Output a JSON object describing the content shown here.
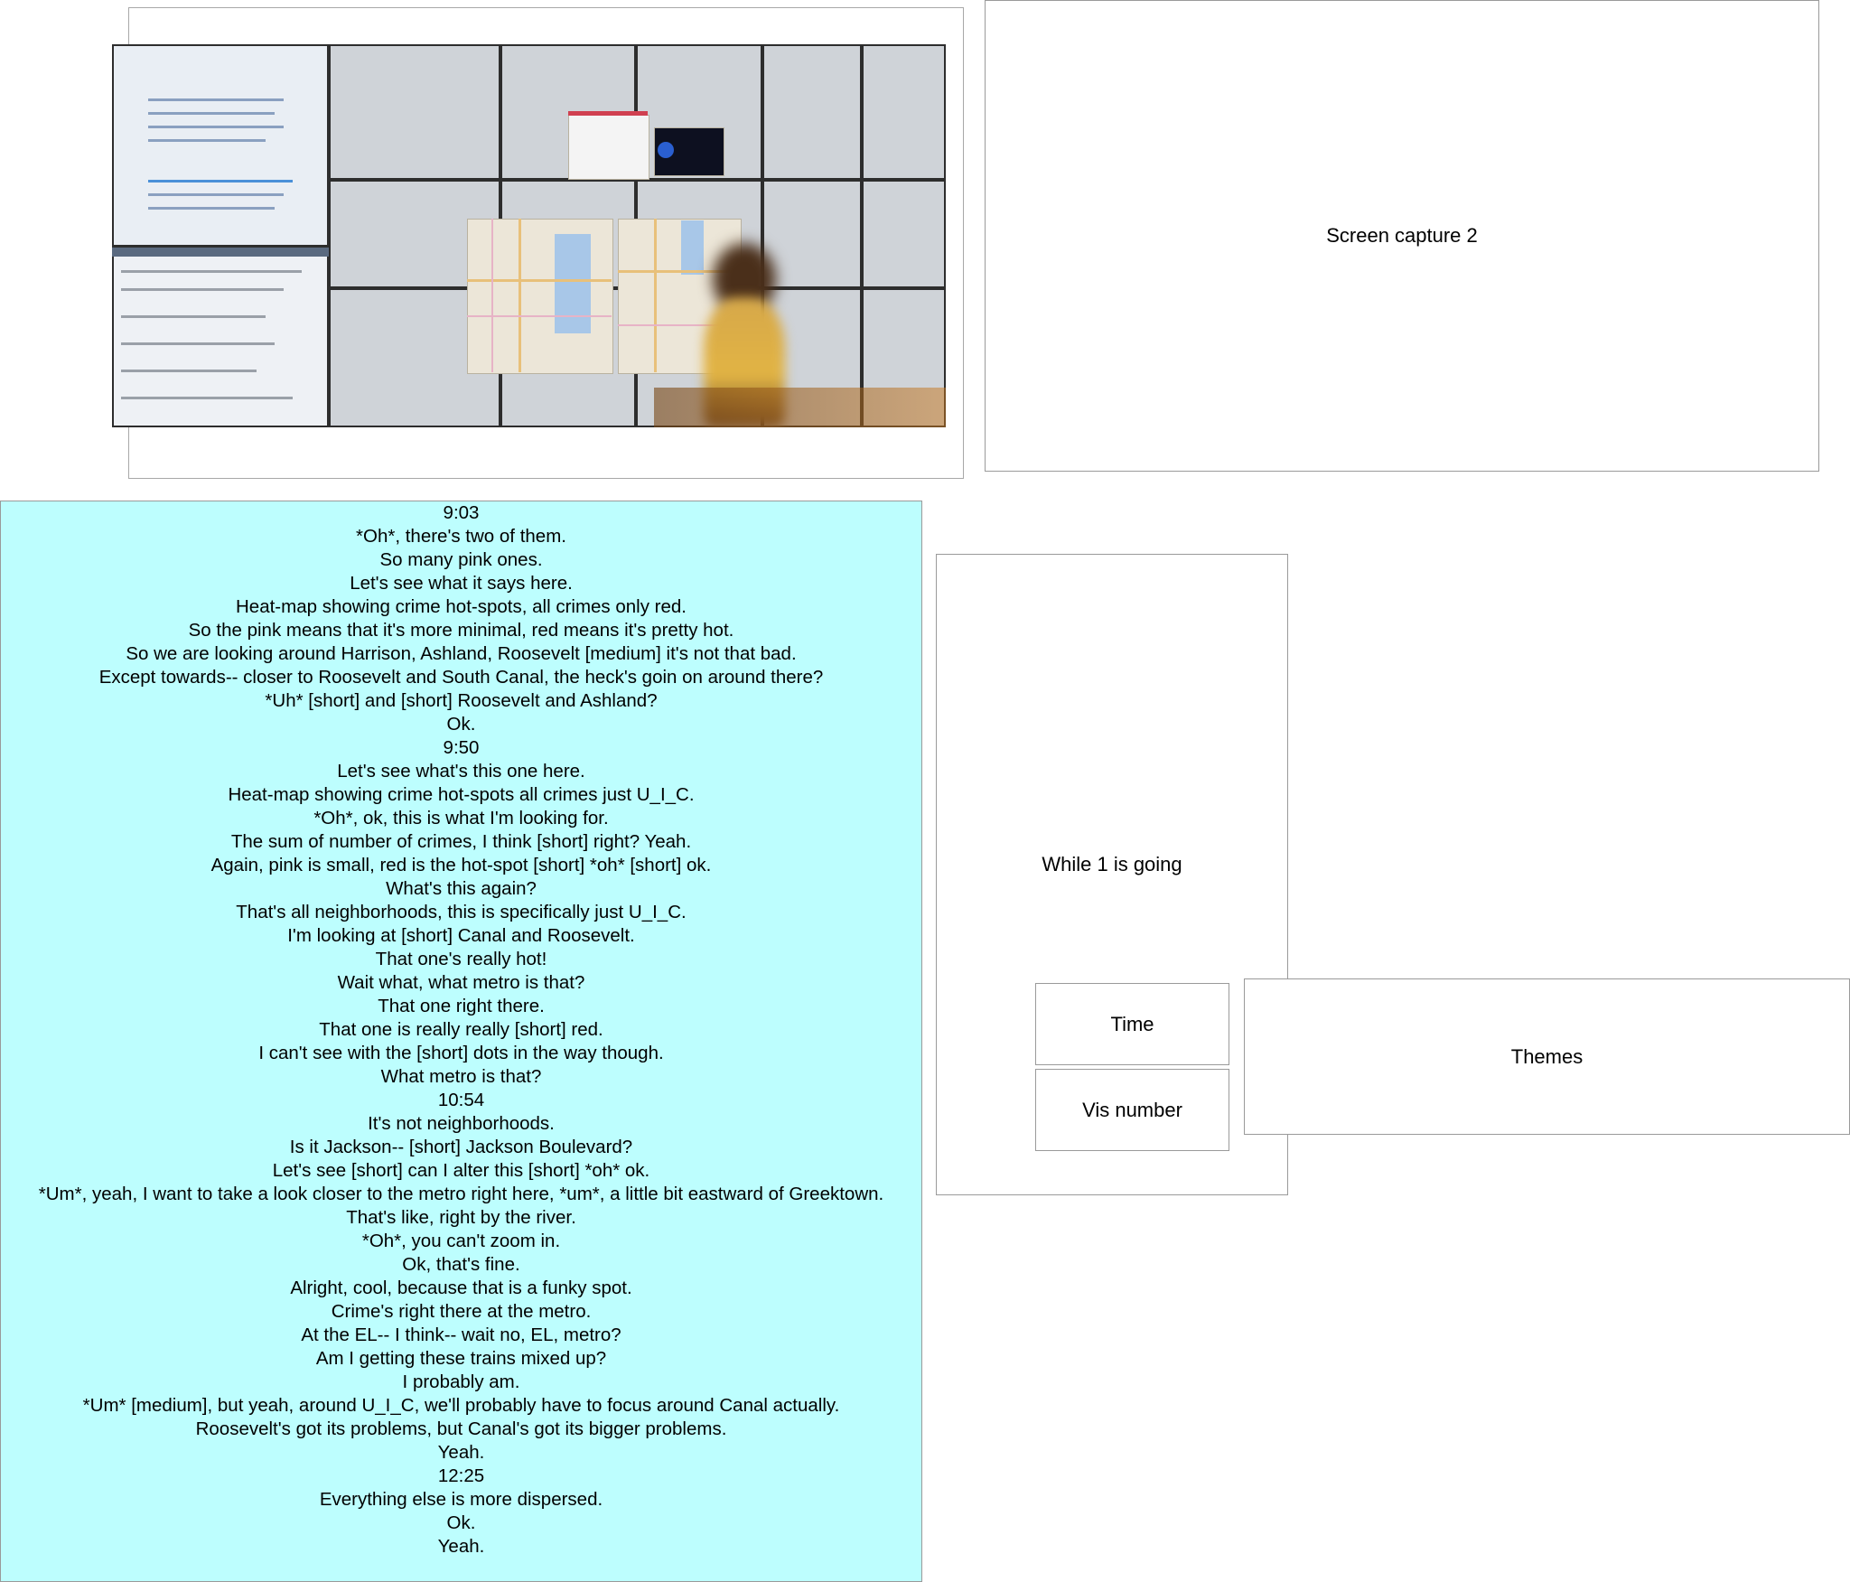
{
  "screen_capture_2": {
    "label": "Screen capture 2"
  },
  "photo": {
    "description_icon": "photo-of-wall-display"
  },
  "transcript": {
    "lines": [
      "9:03",
      "*Oh*, there's two of them.",
      "So many pink ones.",
      "Let's see what it says here.",
      "Heat-map showing crime hot-spots, all crimes only red.",
      "So the pink means that it's more minimal, red means it's pretty hot.",
      "So we are looking around Harrison, Ashland, Roosevelt [medium] it's not that bad.",
      "Except towards-- closer to Roosevelt and South Canal, the heck's goin on around there?",
      "*Uh* [short] and [short] Roosevelt and Ashland?",
      "Ok.",
      "9:50",
      "Let's see what's this one here.",
      "Heat-map showing crime hot-spots all crimes just U_I_C.",
      "*Oh*, ok, this is what I'm looking for.",
      "The sum of number of crimes, I think [short] right? Yeah.",
      "Again, pink is small, red is the hot-spot [short] *oh* [short] ok.",
      "What's this again?",
      "That's all neighborhoods, this is specifically just U_I_C.",
      "I'm looking at [short] Canal and Roosevelt.",
      "That one's really hot!",
      "Wait what, what metro is that?",
      "That one right there.",
      "That one is really really [short] red.",
      "I can't see with the [short] dots in the way though.",
      "What metro is that?",
      "10:54",
      "It's not neighborhoods.",
      "Is it Jackson-- [short] Jackson Boulevard?",
      "Let's see [short] can I alter this [short] *oh* ok.",
      "*Um*, yeah, I want to take a look closer to the metro right here, *um*, a little bit eastward of Greektown.",
      "That's like, right by the river.",
      "*Oh*, you can't zoom in.",
      "Ok, that's fine.",
      "Alright, cool, because that is a funky spot.",
      "Crime's right there at the metro.",
      "At the EL-- I think-- wait no, EL, metro?",
      "Am I getting these trains mixed up?",
      "I probably am.",
      "*Um* [medium], but yeah, around U_I_C, we'll probably have to focus around Canal actually.",
      "Roosevelt's got its problems, but Canal's got its bigger problems.",
      "Yeah.",
      "12:25",
      "Everything else is more dispersed.",
      "Ok.",
      "Yeah."
    ]
  },
  "while_box": {
    "label": "While 1 is going"
  },
  "time_box": {
    "label": "Time"
  },
  "vis_box": {
    "label": "Vis number"
  },
  "themes_box": {
    "label": "Themes"
  }
}
